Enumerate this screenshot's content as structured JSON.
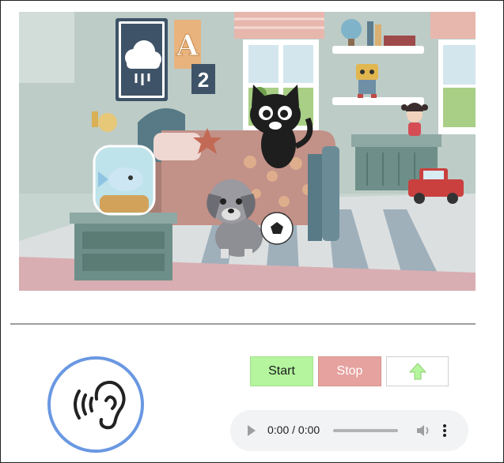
{
  "scene": {
    "name": "bedroom-illustration",
    "cloud_poster_symbol": "☁",
    "letter_block": "A",
    "number_block": "2"
  },
  "controls": {
    "start_label": "Start",
    "stop_label": "Stop",
    "up_icon": "arrow-up-icon"
  },
  "audio": {
    "time": "0:00 / 0:00",
    "progress": 0
  },
  "colors": {
    "start_bg": "#b4f59e",
    "stop_bg": "#e6a29f",
    "ear_ring": "#6a98e2",
    "up_arrow": "#b4f59e"
  }
}
